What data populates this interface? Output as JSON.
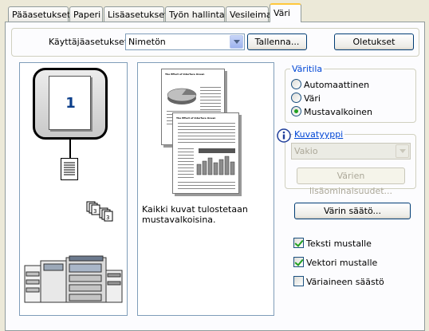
{
  "tabs": [
    {
      "label": "Pääasetukset"
    },
    {
      "label": "Paperi"
    },
    {
      "label": "Lisäasetukset"
    },
    {
      "label": "Työn hallinta"
    },
    {
      "label": "Vesileimat"
    },
    {
      "label": "Väri"
    }
  ],
  "active_tab": "Väri",
  "settings": {
    "user_settings_label": "Käyttäjäasetukset:",
    "user_settings_value": "Nimetön",
    "save_button": "Tallenna...",
    "defaults_button": "Oletukset"
  },
  "preview": {
    "page_number": "1",
    "doc_title": "The Effect of Interface Ocean",
    "description": "Kaikki kuvat tulostetaan mustavalkoisina."
  },
  "color_mode": {
    "title": "Väritila",
    "options": [
      {
        "label": "Automaattinen",
        "selected": false
      },
      {
        "label": "Väri",
        "selected": false
      },
      {
        "label": "Mustavalkoinen",
        "selected": true
      }
    ]
  },
  "image_type": {
    "title": "Kuvatyyppi",
    "value": "Vakio",
    "advanced_button": "Värien lisäominaisuudet..."
  },
  "color_adjust_button": "Värin säätö...",
  "checkboxes": [
    {
      "label": "Teksti mustalle",
      "checked": true
    },
    {
      "label": "Vektori mustalle",
      "checked": true
    },
    {
      "label": "Väriaineen säästö",
      "checked": false
    }
  ],
  "colors": {
    "accent": "#0046D5",
    "tab_highlight": "#FFC83C",
    "dialog_bg": "#ECE9D8"
  }
}
